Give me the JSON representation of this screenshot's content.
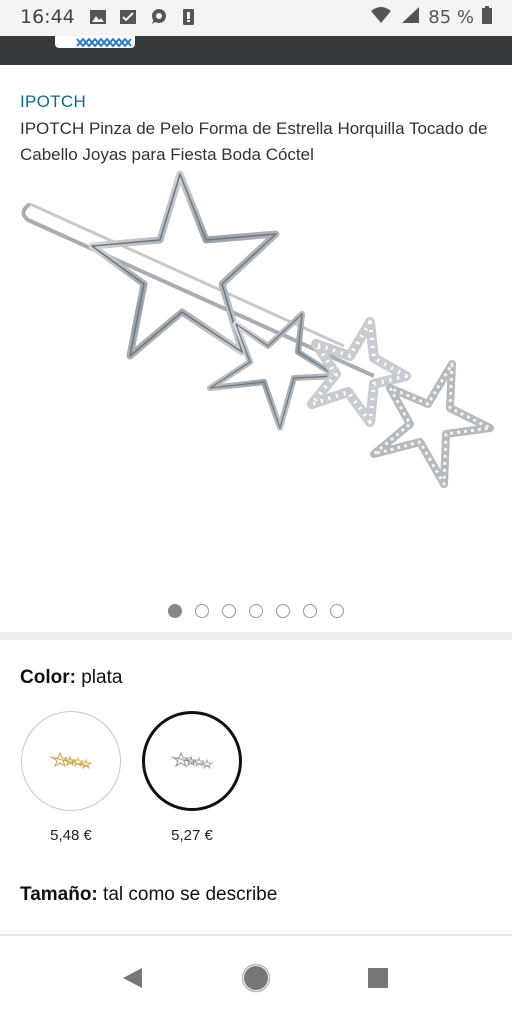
{
  "status_bar": {
    "time": "16:44",
    "battery_percent": "85 %",
    "icons": [
      "image-icon",
      "check-app-icon",
      "chat-icon",
      "sim-icon",
      "wifi-icon",
      "signal-icon",
      "battery-icon"
    ]
  },
  "product": {
    "brand": "IPOTCH",
    "title": "IPOTCH Pinza de Pelo Forma de Estrella Horquilla Tocado de Cabello Joyas para Fiesta Boda Cóctel",
    "image_count": 7,
    "active_image_index": 0
  },
  "variations": {
    "color_label": "Color:",
    "color_value": "plata",
    "swatches": [
      {
        "name": "dorado",
        "price": "5,48 €",
        "selected": false,
        "color": "#c9a24a"
      },
      {
        "name": "plata",
        "price": "5,27 €",
        "selected": true,
        "color": "#9ea3a8"
      }
    ],
    "size_label": "Tamaño:",
    "size_value": "tal como se describe"
  },
  "colors": {
    "brand_link": "#0a6e8a",
    "header_bar": "#363a3d",
    "nav_icons": "#777777"
  }
}
